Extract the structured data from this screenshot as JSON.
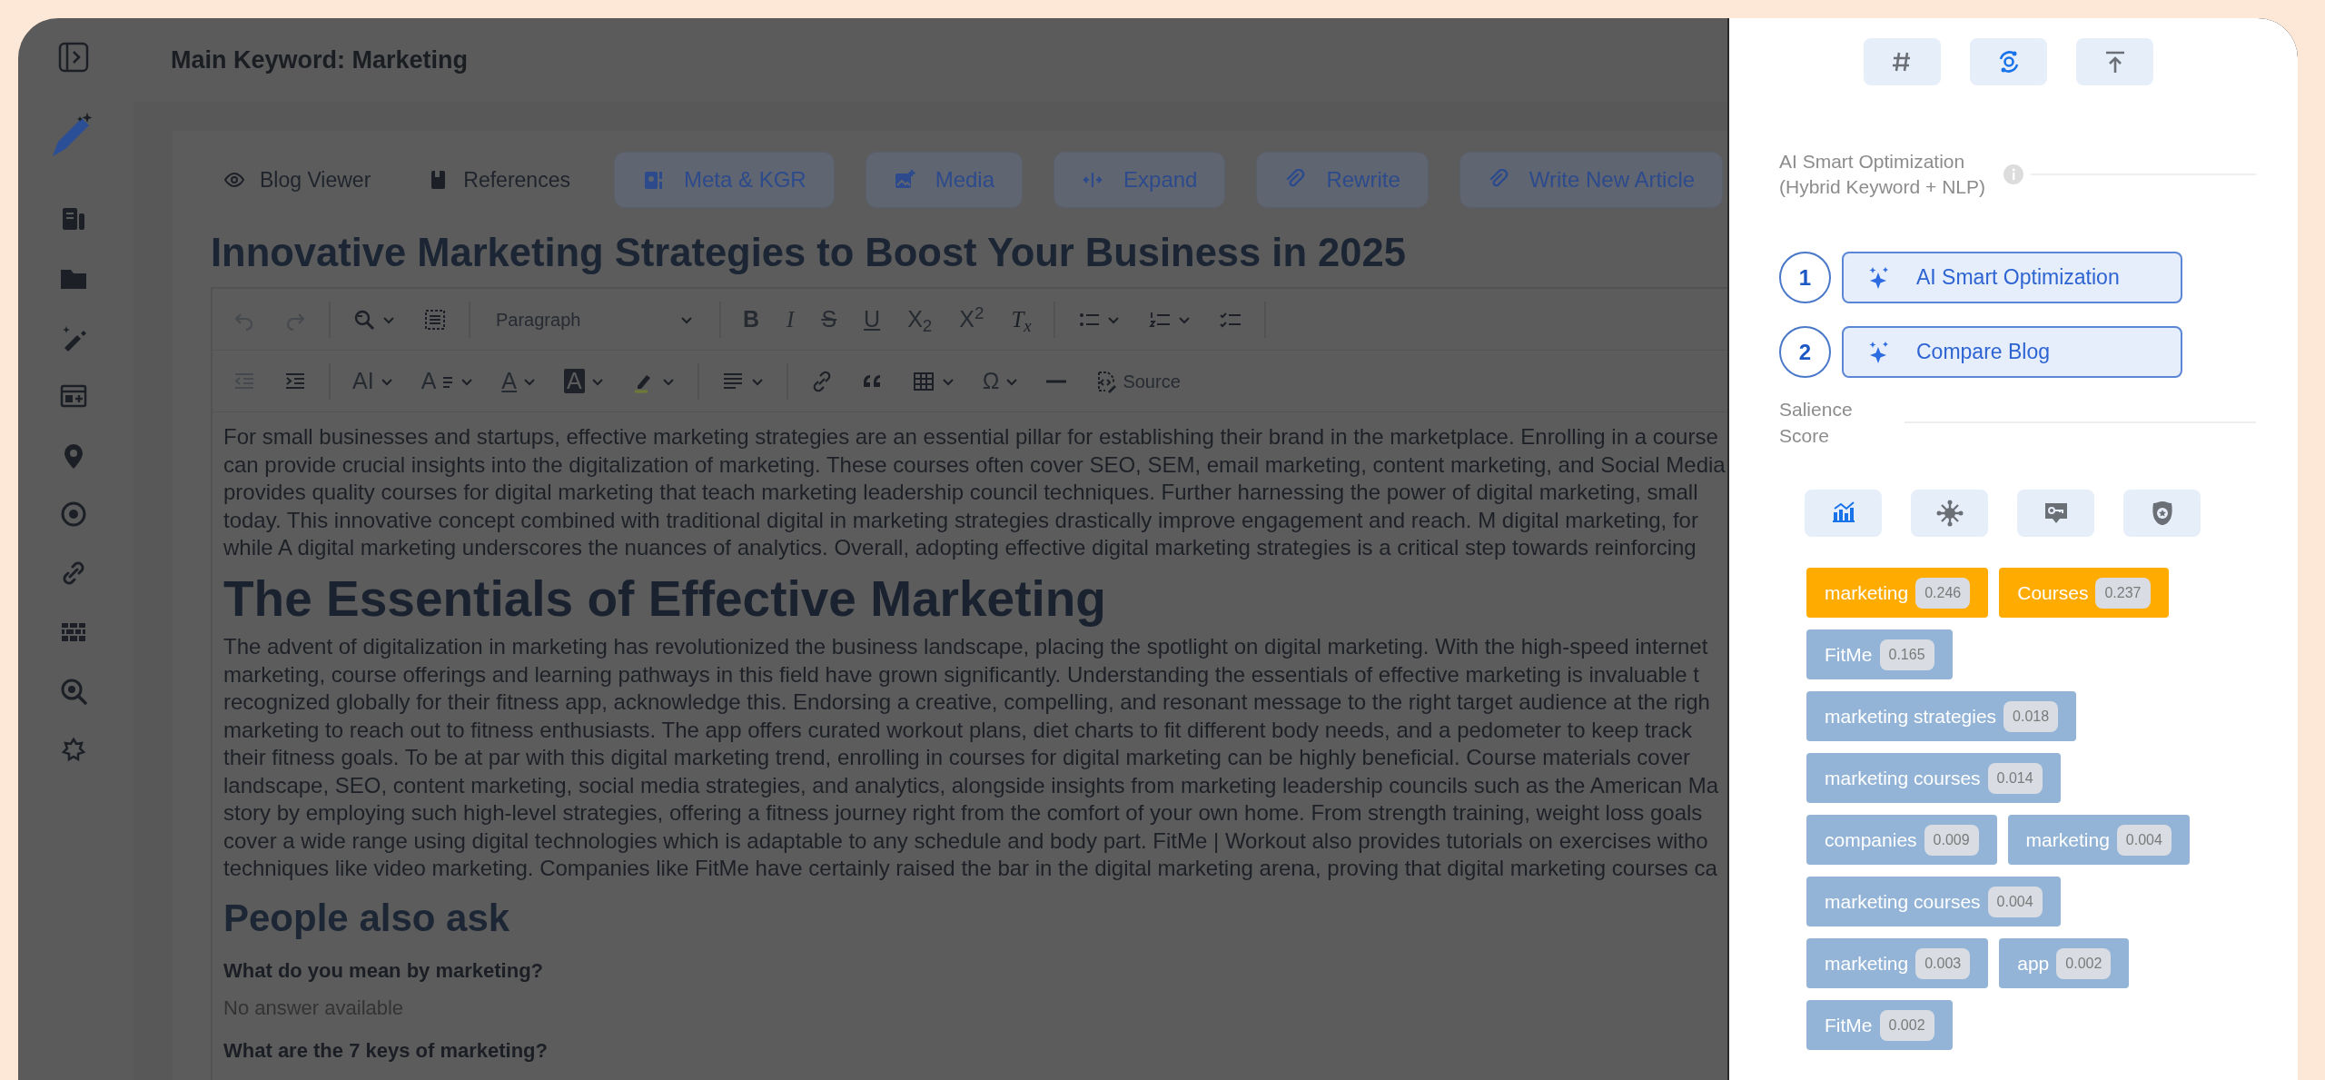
{
  "header": {
    "title": "Main Keyword: Marketing"
  },
  "actions": [
    {
      "label": "Blog Viewer",
      "kind": "plain"
    },
    {
      "label": "References",
      "kind": "plain"
    },
    {
      "label": "Meta & KGR",
      "kind": "filled"
    },
    {
      "label": "Media",
      "kind": "filled"
    },
    {
      "label": "Expand",
      "kind": "filled"
    },
    {
      "label": "Rewrite",
      "kind": "filled"
    },
    {
      "label": "Write New Article",
      "kind": "filled"
    }
  ],
  "article_title": "Innovative Marketing Strategies to Boost Your Business in 2025",
  "editor": {
    "block_format": "Paragraph",
    "source_label": "Source",
    "glyphs": [
      "B",
      "I",
      "S",
      "U",
      "X$_{2}$",
      "X$^{2}$",
      "T$_{x}$",
      "AI",
      "A",
      "A",
      "A",
      "Ω"
    ]
  },
  "content": [
    {
      "kind": "paragraph",
      "lines": [
        "For small businesses and startups, effective marketing strategies are an essential pillar for establishing their brand in the marketplace. Enrolling in a course",
        "can provide crucial insights into the digitalization of marketing. These courses often cover SEO, SEM, email marketing, content marketing, and Social Media",
        "provides quality courses for digital marketing that teach marketing leadership council techniques. Further harnessing the power of digital marketing, small",
        "today. This innovative concept combined with traditional digital in marketing strategies drastically improve engagement and reach. M digital marketing, for",
        "while A digital marketing underscores the nuances of analytics. Overall, adopting effective digital marketing strategies is a critical step towards reinforcing"
      ]
    },
    {
      "kind": "heading",
      "text": "The Essentials of Effective Marketing"
    },
    {
      "kind": "paragraph",
      "lines": [
        "The advent of digitalization in marketing has revolutionized the business landscape, placing the spotlight on digital marketing. With the high-speed internet",
        "marketing, course offerings and learning pathways in this field have grown significantly. Understanding the essentials of effective marketing is invaluable t",
        "recognized globally for their fitness app, acknowledge this. Endorsing a creative, compelling, and resonant message to the right target audience at the righ",
        "marketing to reach out to fitness enthusiasts. The app offers curated workout plans, diet charts to fit different body needs, and a pedometer to keep track",
        "their fitness goals. To be at par with this digital marketing trend, enrolling in courses for digital marketing can be highly beneficial. Course materials cover",
        "landscape, SEO, content marketing, social media strategies, and analytics, alongside insights from marketing leadership councils such as the American Ma",
        "story by employing such high-level strategies, offering a fitness journey right from the comfort of your own home. From strength training, weight loss goals",
        "cover a wide range using digital technologies which is adaptable to any schedule and body part. FitMe | Workout also provides tutorials on exercises witho",
        "techniques like video marketing. Companies like FitMe have certainly raised the bar in the digital marketing arena, proving that digital marketing courses ca"
      ]
    },
    {
      "kind": "subheading",
      "text": "People also ask"
    },
    {
      "kind": "question",
      "text": "What do you mean by marketing?"
    },
    {
      "kind": "answer",
      "text": "No answer available"
    },
    {
      "kind": "question",
      "text": "What are the 7 keys of marketing?"
    }
  ],
  "panel": {
    "top_buttons": [
      {
        "selected": false
      },
      {
        "selected": true
      },
      {
        "selected": false
      }
    ],
    "optimization_label": "AI Smart Optimization (Hybrid Keyword + NLP)",
    "steps": [
      {
        "number": "1",
        "label": "AI Smart Optimization"
      },
      {
        "number": "2",
        "label": "Compare Blog"
      }
    ],
    "salience_label": "Salience Score",
    "view_tabs": [
      {
        "selected": true
      },
      {
        "selected": false
      },
      {
        "selected": false
      },
      {
        "selected": false
      }
    ],
    "keywords": [
      {
        "term": "marketing",
        "score": "0.246",
        "color": "#ffab00"
      },
      {
        "term": "Courses",
        "score": "0.237",
        "color": "#ffab00"
      },
      {
        "term": "FitMe",
        "score": "0.165",
        "color": "#93b4d6"
      },
      {
        "term": "marketing strategies",
        "score": "0.018",
        "color": "#93b4d6"
      },
      {
        "term": "marketing courses",
        "score": "0.014",
        "color": "#93b4d6"
      },
      {
        "term": "companies",
        "score": "0.009",
        "color": "#93b4d6"
      },
      {
        "term": "marketing",
        "score": "0.004",
        "color": "#93b4d6"
      },
      {
        "term": "marketing courses",
        "score": "0.004",
        "color": "#93b4d6"
      },
      {
        "term": "marketing",
        "score": "0.003",
        "color": "#93b4d6"
      },
      {
        "term": "app",
        "score": "0.002",
        "color": "#93b4d6"
      },
      {
        "term": "FitMe",
        "score": "0.002",
        "color": "#93b4d6"
      }
    ]
  }
}
